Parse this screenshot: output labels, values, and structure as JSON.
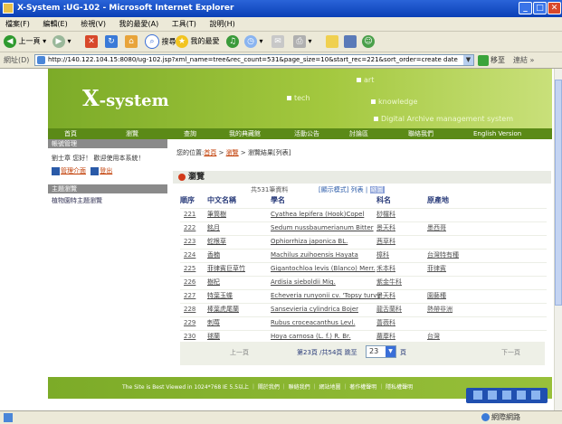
{
  "window": {
    "title": "X-System :UG-102 - Microsoft Internet Explorer",
    "min": "_",
    "max": "□",
    "close": "✕"
  },
  "menubar": [
    "檔案(F)",
    "編輯(E)",
    "檢視(V)",
    "我的最愛(A)",
    "工具(T)",
    "說明(H)"
  ],
  "toolbar": {
    "back": "上一頁",
    "search": "搜尋",
    "favorites": "我的最愛"
  },
  "address": {
    "label": "網址(D)",
    "url": "http://140.122.104.15:8080/ug-102.jsp?xml_name=tree&rec_count=531&page_size=10&start_rec=221&sort_order=create date",
    "go": "移至",
    "links": "連結 »"
  },
  "banner": {
    "logo_x": "X",
    "logo_rest": "-system",
    "art": "art",
    "tech": "tech",
    "knowledge": "knowledge",
    "digital": "Digital Archive management system"
  },
  "nav": [
    "首頁",
    "瀏覽",
    "查詢",
    "我的典藏館",
    "活動公告",
    "討論區",
    "聯絡我們",
    "English Version"
  ],
  "sidebar": {
    "header1": "帳號管理",
    "welcome": "劉士章 您好！ 歡迎使用本系統！",
    "manage": "管理介面",
    "logout": "登出",
    "header2": "主題瀏覽",
    "item": "植物園特主題瀏覽"
  },
  "breadcrumb": {
    "prefix": "您的位置:",
    "home": "首頁",
    "sep1": " > ",
    "browse": "瀏覽",
    "rest": " > 瀏覽結果[列表]"
  },
  "section": {
    "title": "瀏覽"
  },
  "results": {
    "total": "共531筆資料",
    "mode_prefix": "[顯示模式] 列表 | ",
    "mode_current": "縮圖"
  },
  "table": {
    "headers": {
      "no": "順序",
      "cn": "中文名稱",
      "sci": "學名",
      "fam": "科名",
      "area": "原產地"
    },
    "rows": [
      {
        "no": "221",
        "cn": "筆筒樹",
        "sci": "Cyathea lepifera (Hook)Copel",
        "fam": "桫欏科",
        "area": ""
      },
      {
        "no": "222",
        "cn": "銘月",
        "sci": "Sedum nussbaumerianum Bitter",
        "fam": "景天科",
        "area": "墨西哥"
      },
      {
        "no": "223",
        "cn": "蛇根草",
        "sci": "Ophiorrhiza japonica BL.",
        "fam": "茜草科",
        "area": ""
      },
      {
        "no": "224",
        "cn": "香楠",
        "sci": "Machilus zuihoensis Hayata",
        "fam": "樟科",
        "area": "台灣特有種"
      },
      {
        "no": "225",
        "cn": "菲律賓巨草竹",
        "sci": "Gigantochloa levis (Blanco) Merr.",
        "fam": "禾本科",
        "area": "菲律賓"
      },
      {
        "no": "226",
        "cn": "樹杞",
        "sci": "Ardisia sieboldii Miq.",
        "fam": "紫金牛科",
        "area": ""
      },
      {
        "no": "227",
        "cn": "特葉玉蝶",
        "sci": "Echeveria runyonii cv. 'Topsy turvy'",
        "fam": "景天科",
        "area": "園藝種"
      },
      {
        "no": "228",
        "cn": "棒葉虎尾蘭",
        "sci": "Sansevieria cylindrica Bojer",
        "fam": "龍舌蘭科",
        "area": "熱帶非洲"
      },
      {
        "no": "229",
        "cn": "刺莓",
        "sci": "Rubus croceacanthus Levl.",
        "fam": "薔薇科",
        "area": ""
      },
      {
        "no": "230",
        "cn": "毬蘭",
        "sci": "Hoya carnosa (L. f.) R. Br.",
        "fam": "蘿藦科",
        "area": "台灣"
      }
    ]
  },
  "pager": {
    "prev": "上一頁",
    "info": "第23頁 /共54頁 跳至",
    "page": "23",
    "unit": "頁",
    "next": "下一頁"
  },
  "footer": {
    "text": "The Site is Best Viewed in 1024*768 IE 5.5以上 ｜ 關於我們 ｜ 聯絡我們 ｜ 網站地圖 ｜ 著作權聲明 ｜ 隱私權聲明"
  },
  "status": {
    "zone": "網際網路"
  }
}
